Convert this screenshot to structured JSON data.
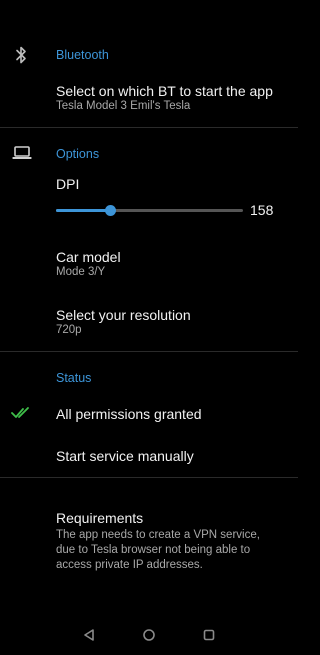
{
  "bluetooth": {
    "section_title": "Bluetooth",
    "icon": "bluetooth-icon",
    "select_bt": {
      "title": "Select on which BT to start the app",
      "value": "Tesla Model 3 Emil's Tesla"
    }
  },
  "options": {
    "section_title": "Options",
    "icon": "laptop-icon",
    "dpi": {
      "label": "DPI",
      "value": "158",
      "fill_fraction": 0.29
    },
    "car_model": {
      "title": "Car model",
      "value": "Mode 3/Y"
    },
    "resolution": {
      "title": "Select your resolution",
      "value": "720p"
    }
  },
  "status": {
    "section_title": "Status",
    "permissions": {
      "icon": "double-check-icon",
      "label": "All permissions granted"
    },
    "start_service": {
      "label": "Start service manually"
    }
  },
  "requirements": {
    "title": "Requirements",
    "body": "The app needs to create a VPN service, due to Tesla browser not being able to access private IP addresses."
  },
  "navbar": {
    "back": "back-triangle-icon",
    "home": "home-circle-icon",
    "recents": "recents-square-icon"
  },
  "colors": {
    "accent": "#3d95d8",
    "check": "#3fbf4a",
    "background": "#000000"
  }
}
